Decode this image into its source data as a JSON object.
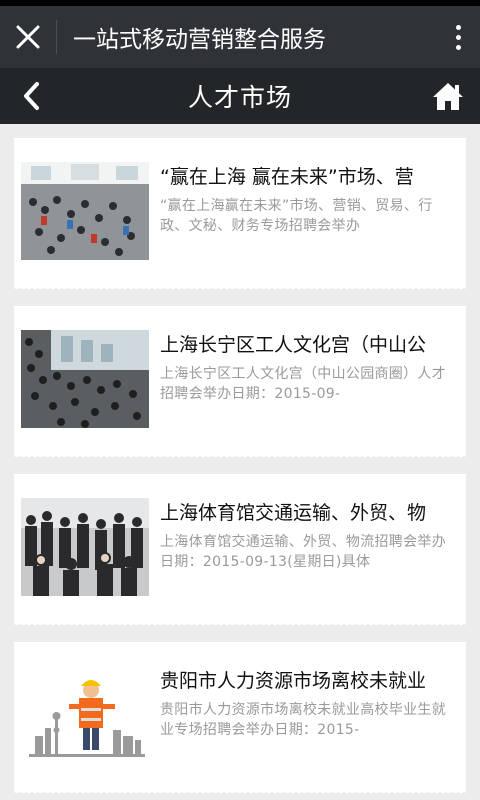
{
  "app_bar": {
    "title": "一站式移动营销整合服务",
    "close_icon": "close-icon",
    "more_icon": "more-vertical-icon"
  },
  "nav_bar": {
    "title": "人才市场",
    "back_icon": "chevron-left-icon",
    "home_icon": "home-icon"
  },
  "articles": [
    {
      "title": "“赢在上海 赢在未来”市场、营",
      "summary": "“赢在上海赢在未来”市场、营销、贸易、行政、文秘、财务专场招聘会举办",
      "thumbnail": "job-fair-hall-photo"
    },
    {
      "title": "上海长宁区工人文化宫（中山公",
      "summary": "上海长宁区工人文化宫（中山公园商圈）人才招聘会举办日期：2015-09-",
      "thumbnail": "crowded-recruitment-photo"
    },
    {
      "title": "上海体育馆交通运输、外贸、物",
      "summary": "上海体育馆交通运输、外贸、物流招聘会举办日期：2015-09-13(星期日)具体",
      "thumbnail": "people-queue-photo"
    },
    {
      "title": "贵阳市人力资源市场离校未就业",
      "summary": "贵阳市人力资源市场离校未就业高校毕业生就业专场招聘会举办日期：2015-",
      "thumbnail": "construction-worker-skyline-photo"
    }
  ],
  "colors": {
    "app_bar_bg": "#2f3337",
    "nav_bar_bg": "#232628",
    "page_bg": "#ececec",
    "summary_text": "#9a9a9a"
  }
}
